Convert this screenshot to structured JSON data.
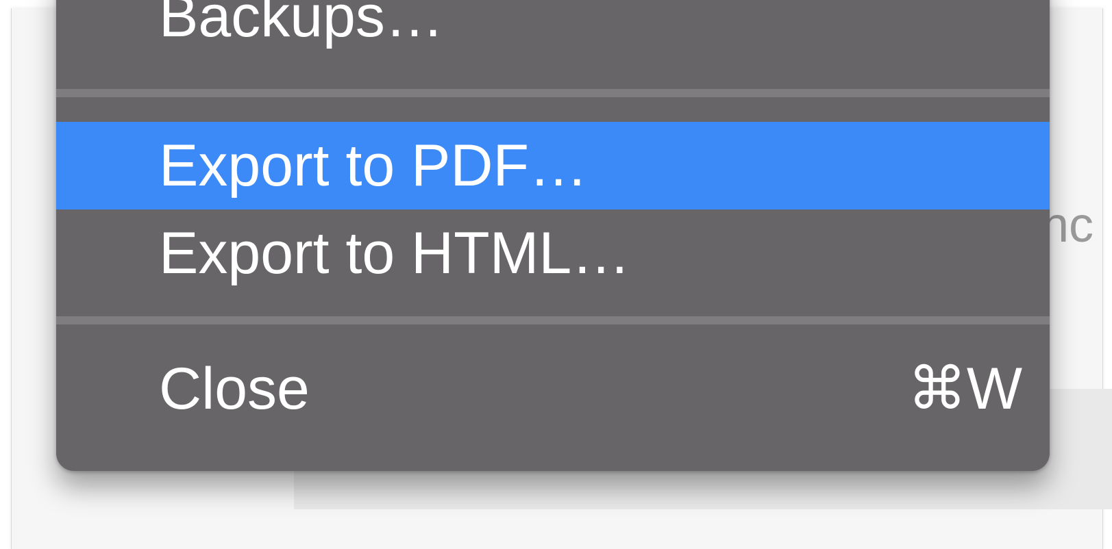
{
  "background": {
    "partial_text": "nc"
  },
  "menu": {
    "items": [
      {
        "label": "Backups…"
      },
      {
        "label": "Export to PDF…",
        "highlighted": true
      },
      {
        "label": "Export to HTML…"
      },
      {
        "label": "Close",
        "shortcut": "⌘W"
      }
    ]
  },
  "colors": {
    "menu_background": "#676568",
    "highlight": "#3c8af8",
    "separator": "#7f7d80",
    "text": "#ffffff"
  }
}
